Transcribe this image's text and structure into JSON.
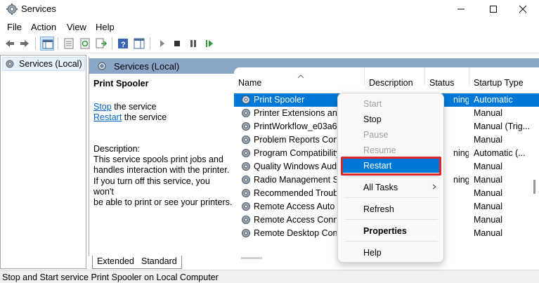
{
  "window": {
    "title": "Services",
    "controls": [
      "minimize",
      "maximize",
      "close"
    ]
  },
  "menu": [
    "File",
    "Action",
    "View",
    "Help"
  ],
  "toolbar": {
    "icons": [
      "back-arrow-icon",
      "forward-arrow-icon",
      "console-tree-icon",
      "properties-icon",
      "refresh-icon",
      "export-list-icon",
      "help-icon",
      "show-hide-icon",
      "start-service-icon",
      "stop-service-icon",
      "pause-service-icon",
      "resume-service-icon"
    ]
  },
  "tree": {
    "label": "Services (Local)"
  },
  "pane": {
    "header": "Services (Local)",
    "selected_service": "Print Spooler",
    "stop_link": "Stop",
    "stop_suffix": " the service",
    "restart_link": "Restart",
    "restart_suffix": " the service",
    "description_label": "Description:",
    "description_lines": [
      "This service spools print jobs and",
      "handles interaction with the printer.",
      "If you turn off this service, you won't",
      "be able to print or see your printers."
    ]
  },
  "list": {
    "columns": [
      "Name",
      "Description",
      "Status",
      "Startup Type"
    ],
    "rows": [
      {
        "name": "Print Spooler",
        "status": "ning",
        "startup": "Automatic",
        "selected": true
      },
      {
        "name": "Printer Extensions and",
        "status": "",
        "startup": "Manual"
      },
      {
        "name": "PrintWorkflow_e03a6",
        "status": "",
        "startup": "Manual (Trig..."
      },
      {
        "name": "Problem Reports Cont",
        "status": "",
        "startup": "Manual"
      },
      {
        "name": "Program Compatibility",
        "status": "ning",
        "startup": "Automatic (..."
      },
      {
        "name": "Quality Windows Audi",
        "status": "",
        "startup": "Manual"
      },
      {
        "name": "Radio Management Se",
        "status": "ning",
        "startup": "Manual"
      },
      {
        "name": "Recommended Troubl",
        "status": "",
        "startup": "Manual"
      },
      {
        "name": "Remote Access Auto C",
        "status": "",
        "startup": "Manual"
      },
      {
        "name": "Remote Access Conne",
        "status": "",
        "startup": "Manual"
      },
      {
        "name": "Remote Desktop Confi",
        "status": "",
        "startup": "Manual"
      }
    ]
  },
  "context_menu": {
    "items": [
      {
        "label": "Start",
        "disabled": true
      },
      {
        "label": "Stop"
      },
      {
        "label": "Pause",
        "disabled": true
      },
      {
        "label": "Resume",
        "disabled": true
      },
      {
        "label": "Restart",
        "highlighted": true
      },
      {
        "label": "All Tasks",
        "submenu": true
      },
      {
        "label": "Refresh"
      },
      {
        "label": "Properties",
        "bold": true
      },
      {
        "label": "Help"
      }
    ]
  },
  "tabs": [
    "Extended",
    "Standard"
  ],
  "status_bar": "Stop and Start service Print Spooler on Local Computer",
  "colors": {
    "selection": "#0078d7",
    "header_bar": "#8ca6c8",
    "annotation_box": "#e0252b",
    "link": "#0066cc"
  }
}
